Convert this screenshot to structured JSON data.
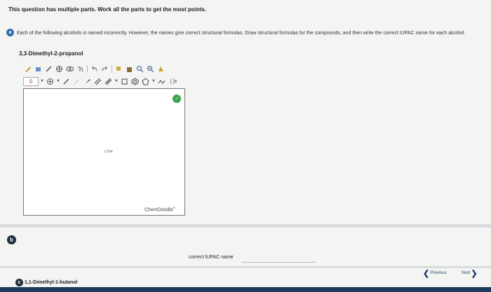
{
  "intro": "This question has multiple parts. Work all the parts to get the most points.",
  "part_a": {
    "badge": "a",
    "instructions": "Each of the following alcohols is named incorrectly. However, the names give correct structural formulas. Draw structural formulas for the compounds, and then write the correct IUPAC name for each alcohol.",
    "compound_name": "3,3-Dimethyl-2-propanol"
  },
  "sketcher": {
    "charge_value": "0",
    "canvas_label": "CH4",
    "brand": "ChemDoodle",
    "brand_mark": "®",
    "bracket_tool": "[ ]±",
    "colors": {
      "check": "#3aa24a",
      "border": "#777777"
    }
  },
  "part_b": {
    "badge": "b",
    "iupac_label": "correct IUPAC name",
    "iupac_value": ""
  },
  "part_c": {
    "badge": "c",
    "compound_name": "1,1-Dimethyl-1-butanol"
  },
  "nav": {
    "previous": "Previous",
    "next": "Next"
  }
}
